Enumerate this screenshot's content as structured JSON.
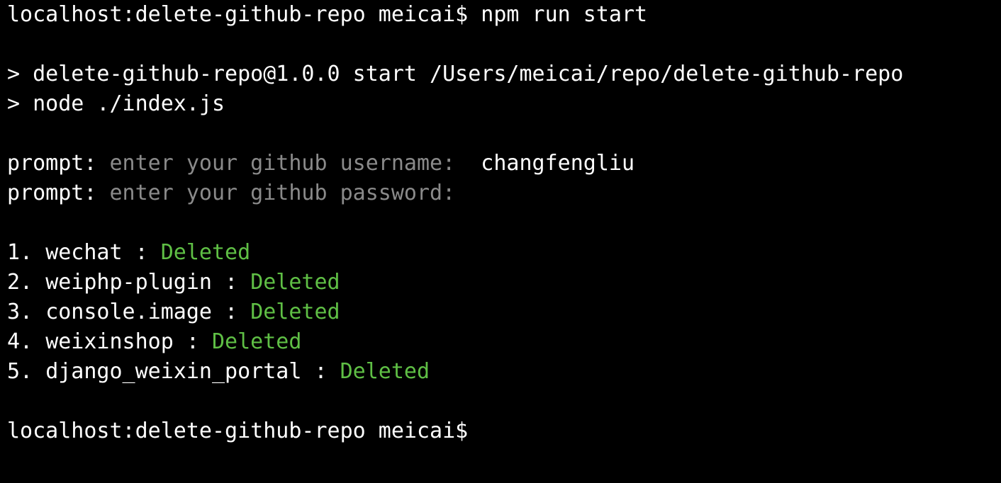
{
  "terminal": {
    "prompt_string": "localhost:delete-github-repo meicai$",
    "command": "npm run start",
    "npm_header": [
      "> delete-github-repo@1.0.0 start /Users/meicai/repo/delete-github-repo",
      "> node ./index.js"
    ],
    "prompts": [
      {
        "label": "prompt:",
        "question": "enter your github username:",
        "answer": "changfengliu"
      },
      {
        "label": "prompt:",
        "question": "enter your github password:",
        "answer": ""
      }
    ],
    "results": [
      {
        "index": "1.",
        "name": "wechat",
        "sep": ":",
        "status": "Deleted"
      },
      {
        "index": "2.",
        "name": "weiphp-plugin",
        "sep": ":",
        "status": "Deleted"
      },
      {
        "index": "3.",
        "name": "console.image",
        "sep": ":",
        "status": "Deleted"
      },
      {
        "index": "4.",
        "name": "weixinshop",
        "sep": ":",
        "status": "Deleted"
      },
      {
        "index": "5.",
        "name": "django_weixin_portal",
        "sep": ":",
        "status": "Deleted"
      }
    ],
    "final_prompt": "localhost:delete-github-repo meicai$",
    "colors": {
      "background": "#000000",
      "text": "#ffffff",
      "dim": "#8a8a8a",
      "success": "#5fbf45"
    }
  }
}
